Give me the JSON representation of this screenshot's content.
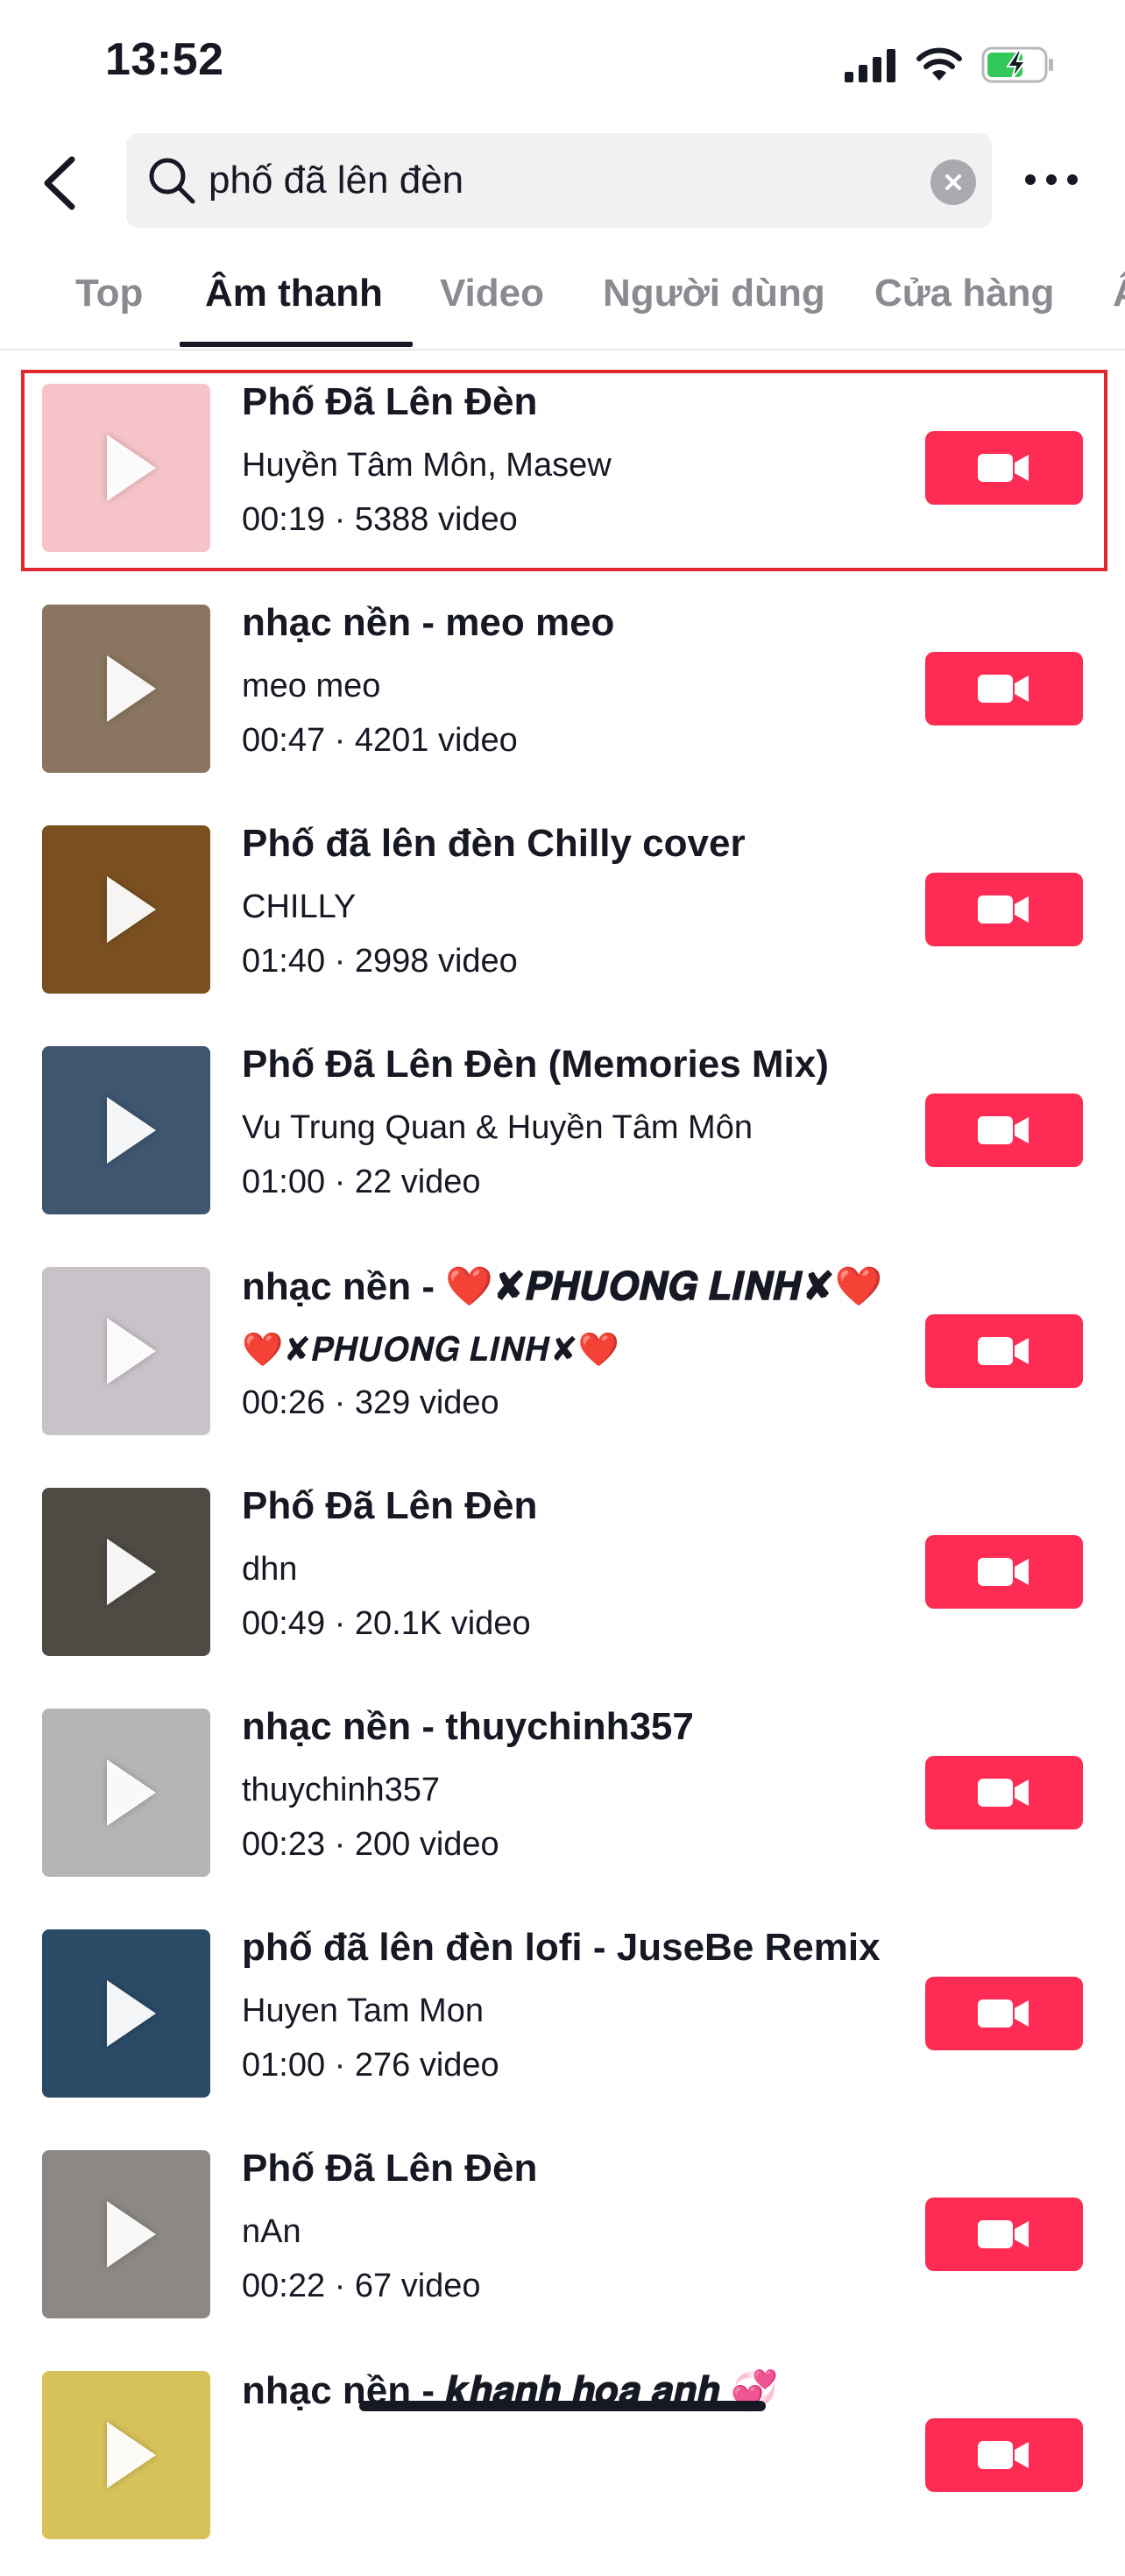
{
  "status_bar": {
    "time": "13:52"
  },
  "header": {
    "search_query": "phố đã lên đèn"
  },
  "tabs": [
    {
      "label": "Top"
    },
    {
      "label": "Âm thanh"
    },
    {
      "label": "Video"
    },
    {
      "label": "Người dùng"
    },
    {
      "label": "Cửa hàng"
    },
    {
      "label": "Â"
    }
  ],
  "active_tab": "Âm thanh",
  "results": [
    {
      "title": "Phố Đã Lên Đèn",
      "artist": "Huyền Tâm Môn, Masew",
      "duration": "00:19",
      "videos": "5388 video",
      "thumb_color": "#f6c3c8"
    },
    {
      "title": "nhạc nền - meo meo",
      "artist": "meo meo",
      "duration": "00:47",
      "videos": "4201 video",
      "thumb_color": "#8a7660"
    },
    {
      "title": "Phố đã lên đèn Chilly cover",
      "artist": "CHILLY",
      "duration": "01:40",
      "videos": "2998 video",
      "thumb_color": "#7a5020"
    },
    {
      "title": "Phố Đã Lên Đèn (Memories Mix)",
      "artist": "Vu Trung Quan & Huyền Tâm Môn",
      "duration": "01:00",
      "videos": "22 video",
      "thumb_color": "#3e5670"
    },
    {
      "title": "nhạc nền - ❤️✘𝑷𝑯𝑼𝑶𝑵𝑮 𝑳𝑰𝑵𝑯✘❤️",
      "artist": "❤️✘𝑷𝑯𝑼𝑶𝑵𝑮 𝑳𝑰𝑵𝑯✘❤️",
      "duration": "00:26",
      "videos": "329 video",
      "thumb_color": "#c9c2c8"
    },
    {
      "title": "Phố Đã Lên Đèn",
      "artist": "dhn",
      "duration": "00:49",
      "videos": "20.1K video",
      "thumb_color": "#4e4a44"
    },
    {
      "title": "nhạc nền - thuychinh357",
      "artist": "thuychinh357",
      "duration": "00:23",
      "videos": "200 video",
      "thumb_color": "#b5b5b3"
    },
    {
      "title": "phố đã lên đèn lofi - JuseBe Remix",
      "artist": "Huyen Tam Mon",
      "duration": "01:00",
      "videos": "276 video",
      "thumb_color": "#2a4a66"
    },
    {
      "title": "Phố Đã Lên Đèn",
      "artist": "nAn",
      "duration": "00:22",
      "videos": "67 video",
      "thumb_color": "#8c8884"
    },
    {
      "title": "nhạc nền - 𝒌𝒉𝒂𝒏𝒉 𝒉𝒐𝒂 𝒂𝒏𝒉 💞",
      "artist": "",
      "duration": "",
      "videos": "",
      "thumb_color": "#d8c25a"
    }
  ],
  "colors": {
    "accent": "#fe2c55",
    "highlight_border": "#e0282f",
    "battery_green": "#34c759"
  },
  "icons": [
    "back-icon",
    "search-icon",
    "clear-icon",
    "more-icon",
    "play-icon",
    "video-camera-icon",
    "signal-icon",
    "wifi-icon",
    "battery-icon"
  ]
}
